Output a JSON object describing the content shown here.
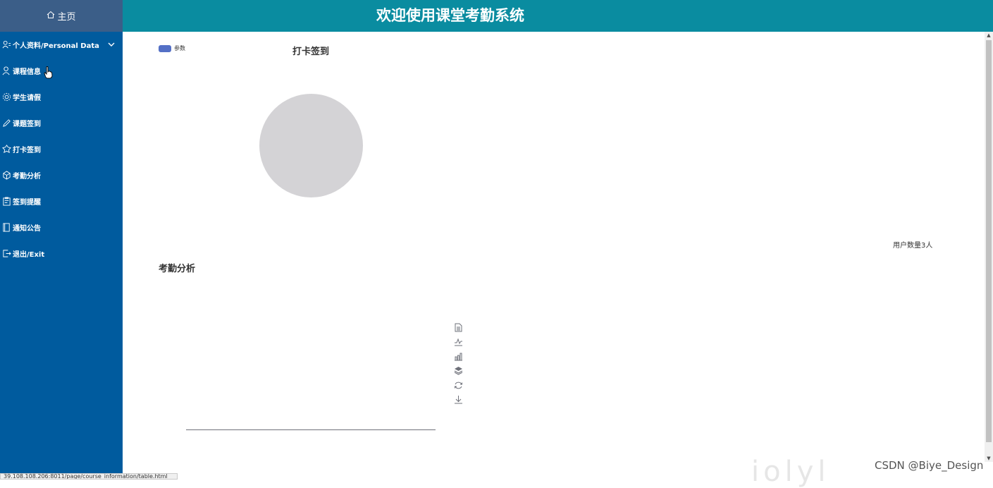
{
  "header": {
    "home_label": "主页",
    "site_title": "欢迎使用课堂考勤系统"
  },
  "sidebar": {
    "items": [
      {
        "label": "个人资料/Personal Data",
        "icon": "user-settings-icon",
        "expandable": true
      },
      {
        "label": "课程信息",
        "icon": "user-icon"
      },
      {
        "label": "学生请假",
        "icon": "gear-icon"
      },
      {
        "label": "课题签到",
        "icon": "pencil-icon"
      },
      {
        "label": "打卡签到",
        "icon": "badge-icon"
      },
      {
        "label": "考勤分析",
        "icon": "cube-icon"
      },
      {
        "label": "签到提醒",
        "icon": "clipboard-icon"
      },
      {
        "label": "通知公告",
        "icon": "book-icon"
      },
      {
        "label": "退出/Exit",
        "icon": "exit-icon"
      }
    ]
  },
  "charts": {
    "checkin": {
      "title": "打卡签到",
      "legend_label": "参数",
      "legend_color": "#5470c6",
      "empty_color": "#d4d3d6",
      "user_count_text": "用户数量3人"
    },
    "analysis": {
      "title": "考勤分析",
      "toolbox": [
        "data-view-icon",
        "line-chart-icon",
        "bar-chart-icon",
        "stack-icon",
        "restore-icon",
        "download-icon"
      ]
    }
  },
  "chart_data": [
    {
      "type": "pie",
      "title": "打卡签到",
      "series": [
        {
          "name": "参数",
          "values": []
        }
      ]
    },
    {
      "type": "bar",
      "title": "考勤分析",
      "categories": [],
      "values": []
    }
  ],
  "statusbar": {
    "url": "39.108.108.206:8011/page/course_information/table.html"
  },
  "watermark": {
    "text": "CSDN @Biye_Design"
  },
  "colors": {
    "topbar": "#0a8ca0",
    "home_block": "#3b5e88",
    "sidebar": "#005b9e"
  }
}
